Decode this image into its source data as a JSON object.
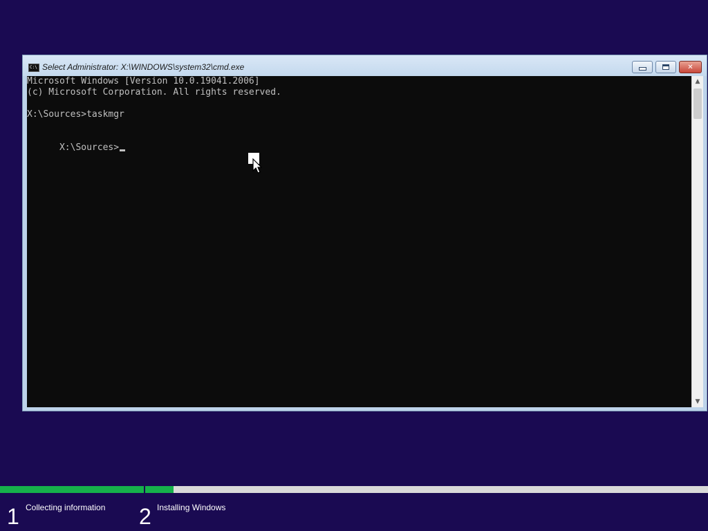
{
  "window": {
    "title": "Select Administrator: X:\\WINDOWS\\system32\\cmd.exe",
    "icon": "cmd-icon"
  },
  "console": {
    "lines": [
      "Microsoft Windows [Version 10.0.19041.2006]",
      "(c) Microsoft Corporation. All rights reserved.",
      "X:\\Sources>taskmgr",
      "X:\\Sources>"
    ]
  },
  "titlebar_controls": {
    "close_glyph": "✕"
  },
  "setup": {
    "steps": [
      {
        "number": "1",
        "label": "Collecting information",
        "progress": 1.0
      },
      {
        "number": "2",
        "label": "Installing Windows",
        "progress": 0.05
      }
    ]
  },
  "colors": {
    "desktop_background": "#1a0a52",
    "progress_fill": "#16b14b",
    "progress_track": "#d9d9d9",
    "console_background": "#0c0c0c",
    "console_text": "#c0c0c0"
  }
}
